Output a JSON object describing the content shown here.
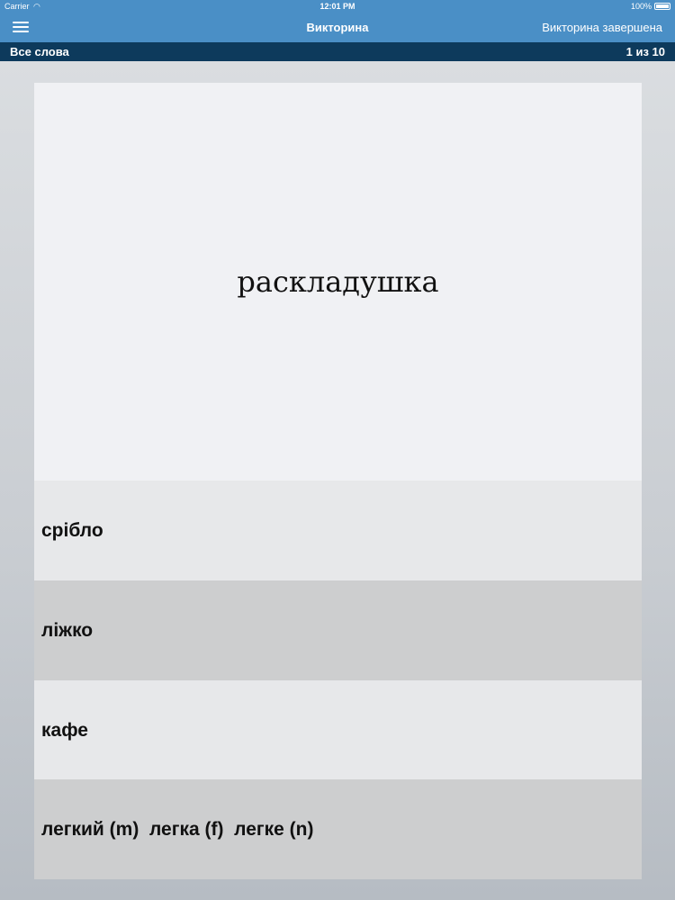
{
  "status_bar": {
    "carrier": "Carrier",
    "wifi_icon": "wifi-icon",
    "time": "12:01 PM",
    "battery": "100%",
    "battery_icon": "battery-icon"
  },
  "nav_bar": {
    "menu_icon": "hamburger-menu-icon",
    "title": "Викторина",
    "finish_label": "Викторина завершена",
    "color": "#4a8fc6"
  },
  "sub_bar": {
    "left_label": "Все слова",
    "progress": "1 из 10",
    "color": "#0d3a5c"
  },
  "quiz": {
    "question_word": "раскладушка",
    "answers": [
      {
        "label": "срібло"
      },
      {
        "label": "ліжко"
      },
      {
        "label": "кафе"
      },
      {
        "label": "легкий (m)  легка (f)  легке (n)"
      }
    ]
  }
}
